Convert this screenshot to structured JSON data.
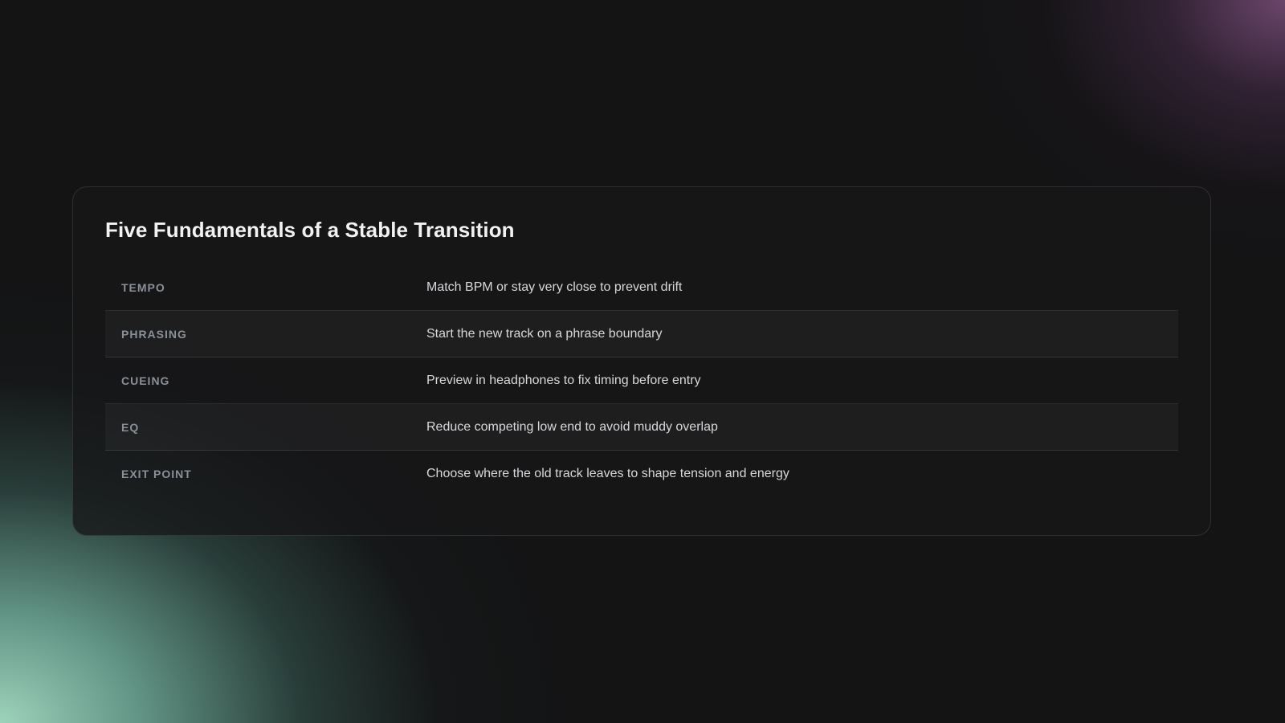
{
  "card": {
    "title": "Five Fundamentals of a Stable Transition"
  },
  "items": [
    {
      "label": "TEMPO",
      "description": "Match BPM or stay very close to prevent drift"
    },
    {
      "label": "PHRASING",
      "description": "Start the new track on a phrase boundary"
    },
    {
      "label": "CUEING",
      "description": "Preview in headphones to fix timing before entry"
    },
    {
      "label": "EQ",
      "description": "Reduce competing low end to avoid muddy overlap"
    },
    {
      "label": "EXIT POINT",
      "description": "Choose where the old track leaves to shape tension and energy"
    }
  ]
}
